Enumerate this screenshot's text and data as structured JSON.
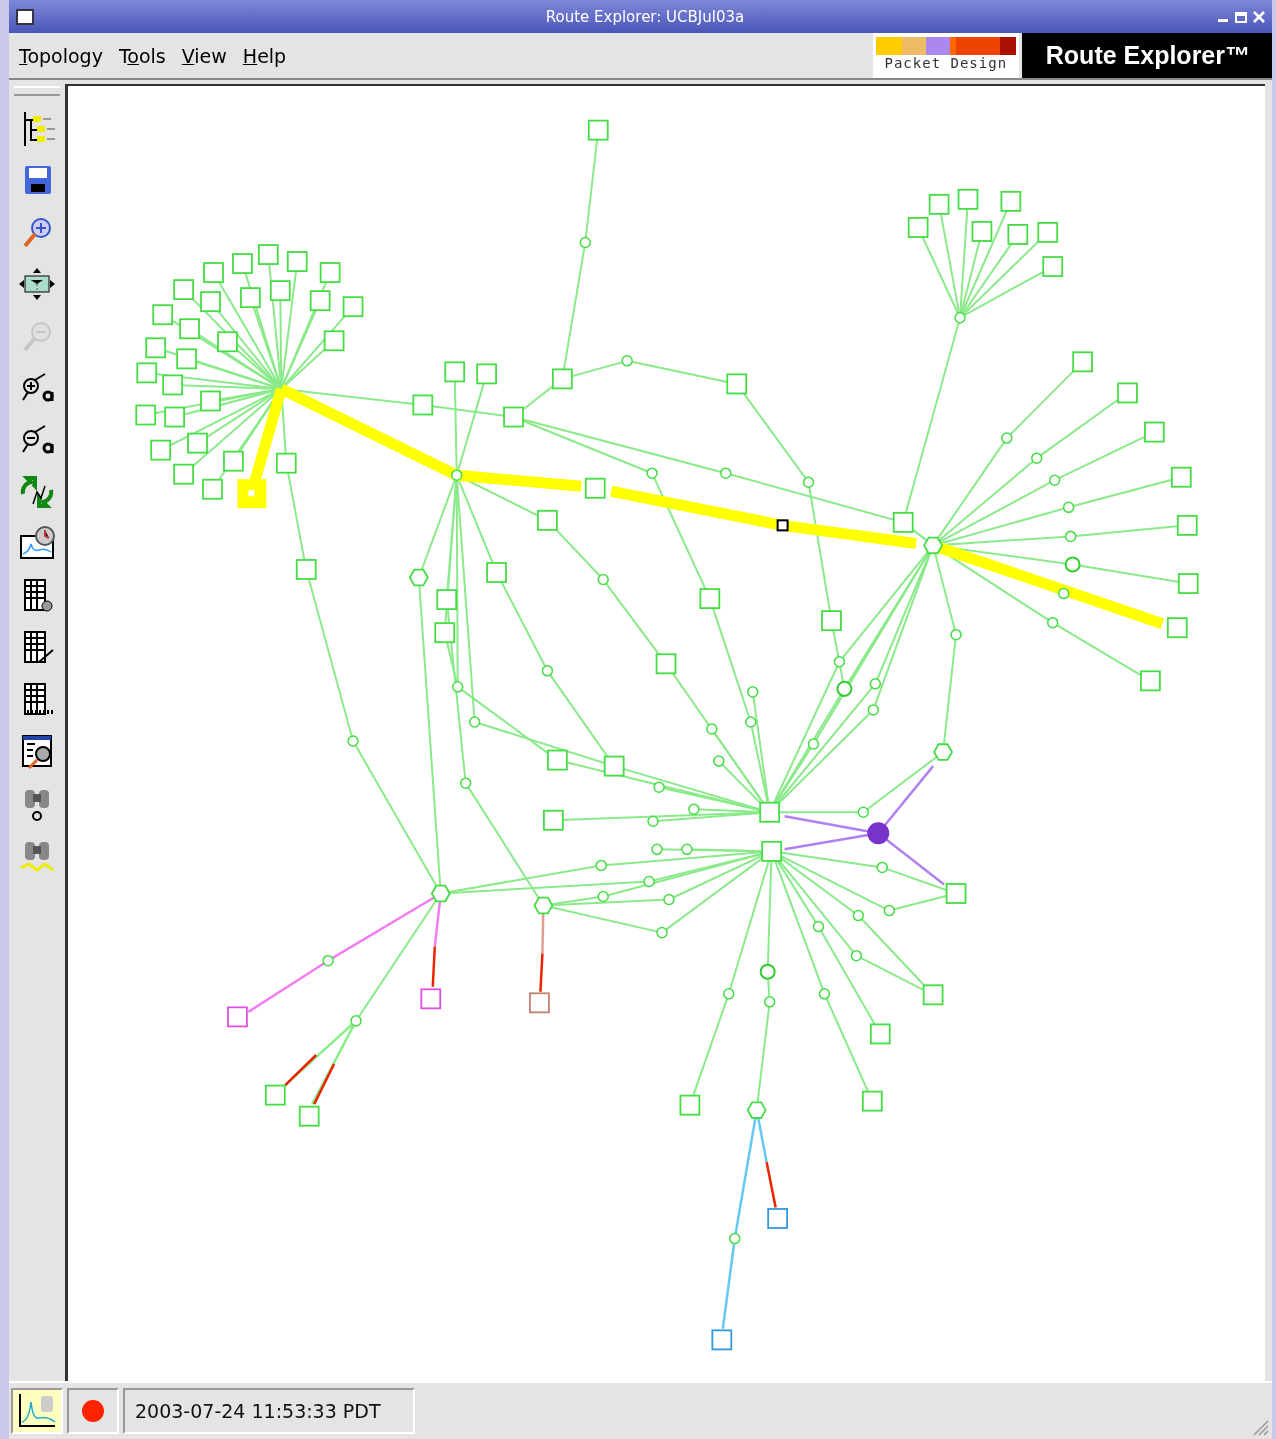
{
  "window": {
    "title": "Route Explorer: UCBJul03a"
  },
  "menu": [
    {
      "key": "T",
      "rest": "opology"
    },
    {
      "before": "T",
      "key": "o",
      "rest": "ols"
    },
    {
      "key": "V",
      "rest": "iew"
    },
    {
      "key": "H",
      "rest": "elp"
    }
  ],
  "brand": {
    "company": "Packet Design",
    "product": "Route Explorer™"
  },
  "toolbar": [
    {
      "kind": "tree",
      "disabled": false
    },
    {
      "kind": "save",
      "disabled": false
    },
    {
      "kind": "zoom-in",
      "disabled": false
    },
    {
      "kind": "fit",
      "disabled": false
    },
    {
      "kind": "zoom-out",
      "disabled": true
    },
    {
      "kind": "label-add",
      "disabled": false
    },
    {
      "kind": "label-remove",
      "disabled": false
    },
    {
      "kind": "refresh",
      "disabled": false
    },
    {
      "kind": "chart",
      "disabled": false
    },
    {
      "kind": "table-dot",
      "disabled": false
    },
    {
      "kind": "table-path",
      "disabled": false
    },
    {
      "kind": "table-ruler",
      "disabled": false
    },
    {
      "kind": "report",
      "disabled": false
    },
    {
      "kind": "find",
      "disabled": false
    },
    {
      "kind": "find-path",
      "disabled": false
    }
  ],
  "status_bar": {
    "recording": true,
    "timestamp": "2003-07-24 11:53:33 PDT"
  }
}
